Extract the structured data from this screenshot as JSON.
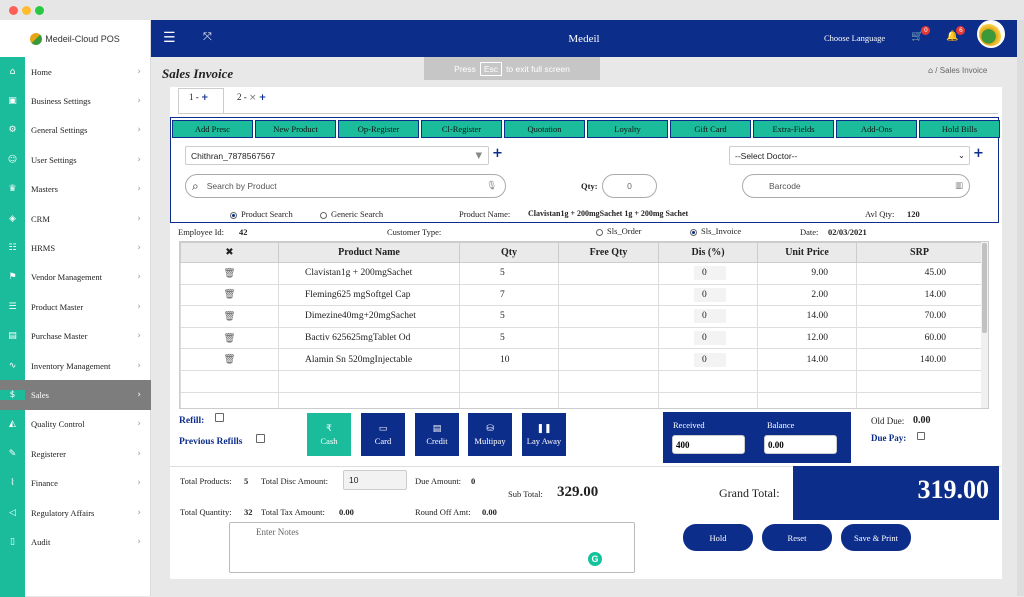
{
  "window": {
    "dot_colors": [
      "#ff5f57",
      "#febc2e",
      "#28c840"
    ]
  },
  "brand": {
    "name": "Medeil-Cloud POS"
  },
  "sidebar": {
    "items": [
      {
        "label": "Home",
        "icon": "home-icon",
        "glyph": "⌂"
      },
      {
        "label": "Business Settings",
        "icon": "save-icon",
        "glyph": "▣"
      },
      {
        "label": "General Settings",
        "icon": "gear-icon",
        "glyph": "⚙"
      },
      {
        "label": "User Settings",
        "icon": "user-icon",
        "glyph": "☺"
      },
      {
        "label": "Masters",
        "icon": "crown-icon",
        "glyph": "♛"
      },
      {
        "label": "CRM",
        "icon": "tag-icon",
        "glyph": "◈"
      },
      {
        "label": "HRMS",
        "icon": "people-icon",
        "glyph": "☷"
      },
      {
        "label": "Vendor Management",
        "icon": "vendor-icon",
        "glyph": "⚑"
      },
      {
        "label": "Product Master",
        "icon": "database-icon",
        "glyph": "☰"
      },
      {
        "label": "Purchase Master",
        "icon": "purchase-icon",
        "glyph": "▤"
      },
      {
        "label": "Inventory Management",
        "icon": "pulse-icon",
        "glyph": "∿"
      },
      {
        "label": "Sales",
        "icon": "dollar-icon",
        "glyph": "$"
      },
      {
        "label": "Quality Control",
        "icon": "quality-icon",
        "glyph": "◭"
      },
      {
        "label": "Registerer",
        "icon": "pencil-icon",
        "glyph": "✎"
      },
      {
        "label": "Finance",
        "icon": "chart-icon",
        "glyph": "⌇"
      },
      {
        "label": "Regulatory Affairs",
        "icon": "megaphone-icon",
        "glyph": "◁"
      },
      {
        "label": "Audit",
        "icon": "book-icon",
        "glyph": "▯"
      }
    ],
    "active_index": 11
  },
  "topbar": {
    "title": "Medeil",
    "choose_language": "Choose Language",
    "cart_badge": "0",
    "bell_badge": "6"
  },
  "fullscreen_banner": {
    "press": "Press",
    "key": "Esc",
    "rest": "to exit full screen"
  },
  "page": {
    "title": "Sales Invoice",
    "breadcrumb_current": "Sales Invoice"
  },
  "tabs": [
    {
      "label": "1 -"
    },
    {
      "label": "2 -"
    }
  ],
  "toolbar": [
    "Add Presc",
    "New Product",
    "Op-Register",
    "Cl-Register",
    "Quotation",
    "Loyalty",
    "Gift Card",
    "Extra-Fields",
    "Add-Ons",
    "Hold Bills"
  ],
  "customer": {
    "value": "Chithran_7878567567"
  },
  "doctor": {
    "value": "--Select Doctor--"
  },
  "search": {
    "placeholder": "Search by Product"
  },
  "qty": {
    "label": "Qty:",
    "value": "0"
  },
  "barcode": {
    "placeholder": "Barcode"
  },
  "search_mode": {
    "product": "Product Search",
    "generic": "Generic Search",
    "selected": "product"
  },
  "product_name": {
    "label": "Product Name:",
    "value": "Clavistan1g + 200mgSachet 1g + 200mg Sachet"
  },
  "avl_qty": {
    "label": "Avl Qty:",
    "value": "120"
  },
  "info": {
    "employee_label": "Employee Id:",
    "employee_id": "42",
    "customer_type_label": "Customer Type:",
    "sls_order": "Sls_Order",
    "sls_invoice": "Sls_Invoice",
    "date_label": "Date:",
    "date": "02/03/2021"
  },
  "grid": {
    "headers": [
      "✖",
      "Product Name",
      "Qty",
      "Free Qty",
      "Dis (%)",
      "Unit Price",
      "SRP"
    ],
    "rows": [
      {
        "name": "Clavistan1g + 200mgSachet",
        "qty": "5",
        "free": "",
        "dis": "0",
        "unit": "9.00",
        "srp": "45.00"
      },
      {
        "name": "Fleming625 mgSoftgel Cap",
        "qty": "7",
        "free": "",
        "dis": "0",
        "unit": "2.00",
        "srp": "14.00"
      },
      {
        "name": "Dimezine40mg+20mgSachet",
        "qty": "5",
        "free": "",
        "dis": "0",
        "unit": "14.00",
        "srp": "70.00"
      },
      {
        "name": "Bactiv 625625mgTablet Od",
        "qty": "5",
        "free": "",
        "dis": "0",
        "unit": "12.00",
        "srp": "60.00"
      },
      {
        "name": "Alamin Sn 520mgInjectable",
        "qty": "10",
        "free": "",
        "dis": "0",
        "unit": "14.00",
        "srp": "140.00"
      }
    ],
    "empty_rows": 2
  },
  "refill": {
    "label": "Refill:",
    "previous": "Previous Refills"
  },
  "pay_buttons": [
    {
      "label": "Cash",
      "glyph": "₹",
      "icon": "rupee-icon",
      "color": "#1abc9c"
    },
    {
      "label": "Card",
      "glyph": "▭",
      "icon": "card-icon",
      "color": "#0d2d8a"
    },
    {
      "label": "Credit",
      "glyph": "▤",
      "icon": "credit-icon",
      "color": "#0d2d8a"
    },
    {
      "label": "Multipay",
      "glyph": "⛁",
      "icon": "multipay-icon",
      "color": "#0d2d8a"
    },
    {
      "label": "Lay Away",
      "glyph": "❚❚",
      "icon": "layaway-icon",
      "color": "#0d2d8a"
    }
  ],
  "received": {
    "label": "Received",
    "value": "400"
  },
  "balance": {
    "label": "Balance",
    "value": "0.00"
  },
  "old_due": {
    "label": "Old Due:",
    "value": "0.00"
  },
  "due_pay": {
    "label": "Due Pay:"
  },
  "totals": {
    "total_products_label": "Total Products:",
    "total_products": "5",
    "total_disc_label": "Total Disc Amount:",
    "total_disc": "10",
    "due_amount_label": "Due Amount:",
    "due_amount": "0",
    "sub_total_label": "Sub Total:",
    "sub_total": "329.00",
    "grand_total_label": "Grand Total:",
    "grand_total": "319.00",
    "total_qty_label": "Total Quantity:",
    "total_qty": "32",
    "total_tax_label": "Total Tax Amount:",
    "total_tax": "0.00",
    "round_off_label": "Round Off Amt:",
    "round_off": "0.00"
  },
  "notes": {
    "placeholder": "Enter Notes"
  },
  "actions": {
    "hold": "Hold",
    "reset": "Reset",
    "save_print": "Save & Print"
  }
}
